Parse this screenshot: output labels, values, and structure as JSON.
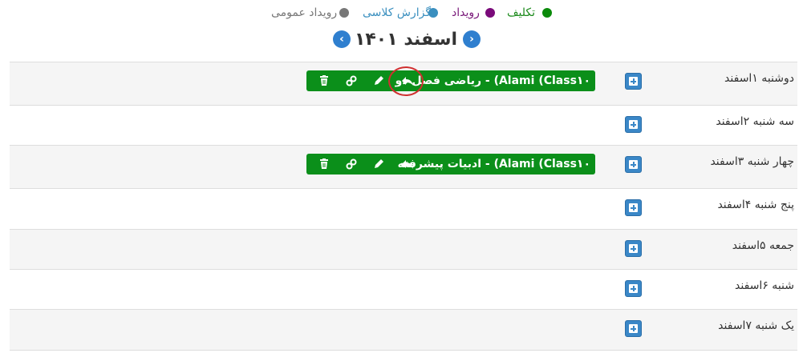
{
  "legend": {
    "assignment": {
      "label": "تکلیف",
      "color": "#0a8a0a"
    },
    "event": {
      "label": "رویداد",
      "color": "#7a0a7a"
    },
    "class_report": {
      "label": "گزارش کلاسی",
      "color": "#3a8fbf"
    },
    "public_event": {
      "label": "رویداد عمومی",
      "color": "#777777"
    }
  },
  "header": {
    "title": "اسفند ۱۴۰۱",
    "prev_icon": "chevron-right-icon",
    "next_icon": "chevron-left-icon"
  },
  "days": [
    {
      "label": "دوشنبه ۱اسفند",
      "add_icon": "plus-square-icon",
      "event": {
        "title": "ریاضی فصل دو - (Alami (Class۱۰",
        "icons": [
          "reply-icon",
          "edit-icon",
          "link-icon",
          "trash-icon"
        ],
        "color": "#0b8f1a"
      }
    },
    {
      "label": "سه شنبه ۲اسفند",
      "add_icon": "plus-square-icon"
    },
    {
      "label": "چهار شنبه ۳اسفند",
      "add_icon": "plus-square-icon",
      "event": {
        "title": "ادبیات پیشرفته - (Alami (Class۱۰",
        "icons": [
          "reply-icon",
          "edit-icon",
          "link-icon",
          "trash-icon"
        ],
        "color": "#0b8f1a"
      }
    },
    {
      "label": "پنج شنبه ۴اسفند",
      "add_icon": "plus-square-icon"
    },
    {
      "label": "جمعه ۵اسفند",
      "add_icon": "plus-square-icon"
    },
    {
      "label": "شنبه ۶اسفند",
      "add_icon": "plus-square-icon"
    },
    {
      "label": "یک شنبه ۷اسفند",
      "add_icon": "plus-square-icon"
    }
  ]
}
